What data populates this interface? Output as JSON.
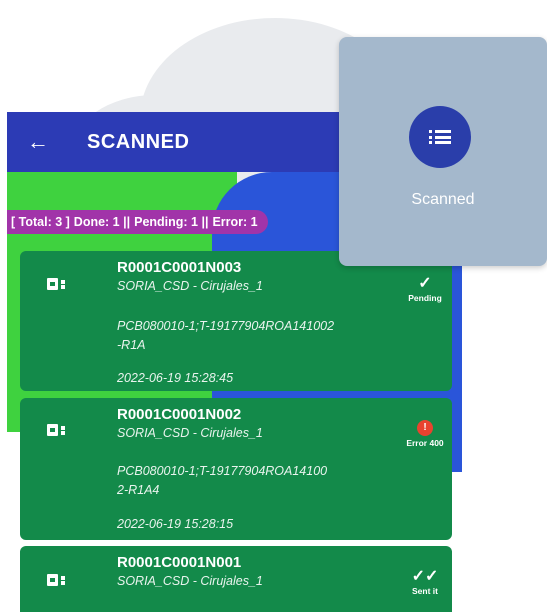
{
  "header": {
    "title": "SCANNED",
    "back_icon": "arrow-back-icon"
  },
  "stats": {
    "total_label": "[ Total: 3 ]",
    "done_label": "Done: 1 ||",
    "pending_label": "Pending: 1 ||",
    "error_label": "Error: 1"
  },
  "cards": [
    {
      "id": "R0001C0001N003",
      "location": "SORIA_CSD - Cirujales_1",
      "code_line1": "PCB080010-1;T-19177904ROA141002",
      "code_line2": "-R1A",
      "timestamp": "2022-06-19 15:28:45",
      "status_glyph": "✓",
      "status_label": "Pending"
    },
    {
      "id": "R0001C0001N002",
      "location": "SORIA_CSD - Cirujales_1",
      "code_line1": "PCB080010-1;T-19177904ROA14100",
      "code_line2": "2-R1A4",
      "timestamp": "2022-06-19 15:28:15",
      "status_glyph": "!",
      "status_label": "Error 400"
    },
    {
      "id": "R0001C0001N001",
      "location": "SORIA_CSD - Cirujales_1",
      "status_glyph": "✓✓",
      "status_label": "Sent it"
    }
  ],
  "popup": {
    "label": "Scanned",
    "icon": "list-icon"
  },
  "colors": {
    "card_green": "#138a4a",
    "topbar_blue": "#2c3bb5",
    "stats_purple": "#a134a9",
    "error_red": "#e8432f"
  }
}
